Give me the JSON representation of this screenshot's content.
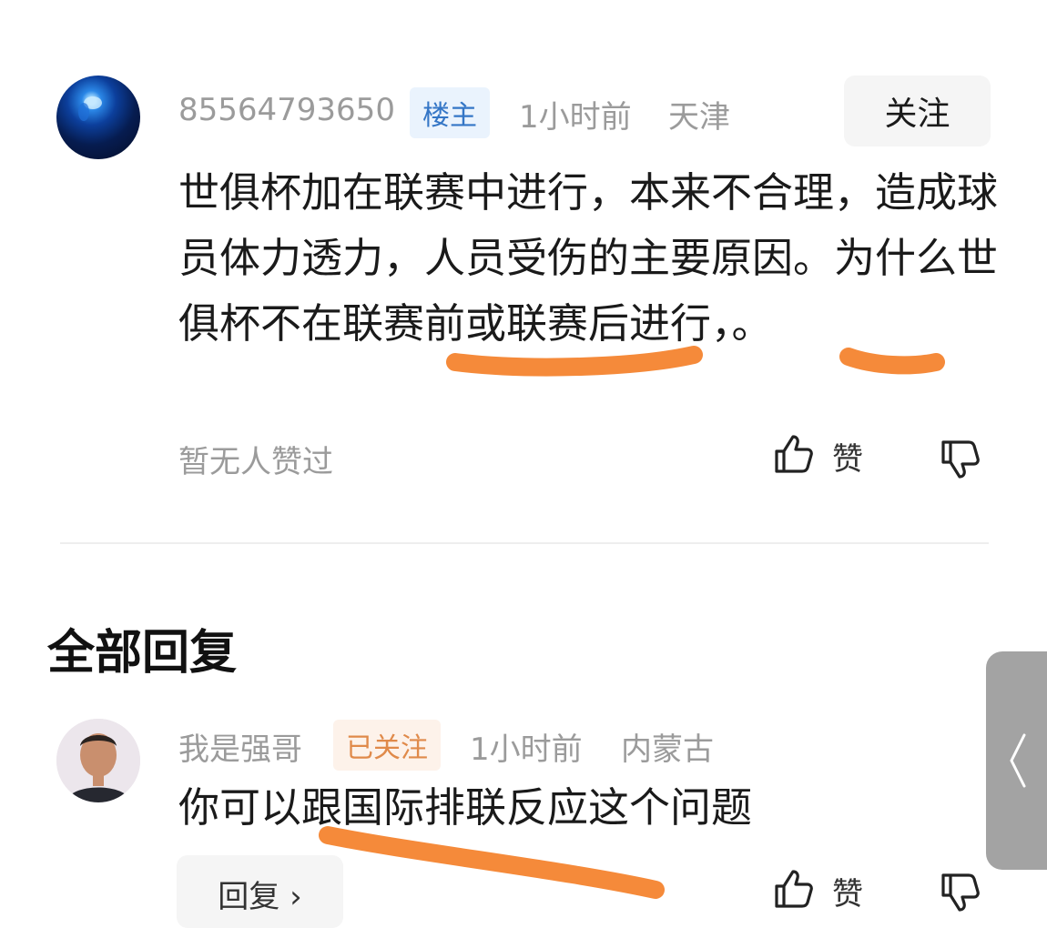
{
  "post": {
    "username": "85564793650",
    "badge": "楼主",
    "time": "1小时前",
    "location": "天津",
    "follow_label": "关注",
    "text": "世俱杯加在联赛中进行，本来不合理，造成球员体力透力，人员受伤的主要原因。为什么世俱杯不在联赛前或联赛后进行，。",
    "likes_status": "暂无人赞过",
    "like_label": "赞"
  },
  "replies_section": {
    "title": "全部回复"
  },
  "reply": {
    "username": "我是强哥",
    "badge": "已关注",
    "time": "1小时前",
    "location": "内蒙古",
    "text": "你可以跟国际排联反应这个问题",
    "reply_label": "回复 ›",
    "like_label": "赞"
  },
  "icons": {
    "like": "thumbs-up-icon",
    "dislike": "thumbs-down-icon",
    "side_handle": "chevron-left-icon"
  },
  "colors": {
    "highlight": "#f58a3a",
    "op_badge": "#3476c6",
    "follow_badge": "#e08a4a"
  }
}
